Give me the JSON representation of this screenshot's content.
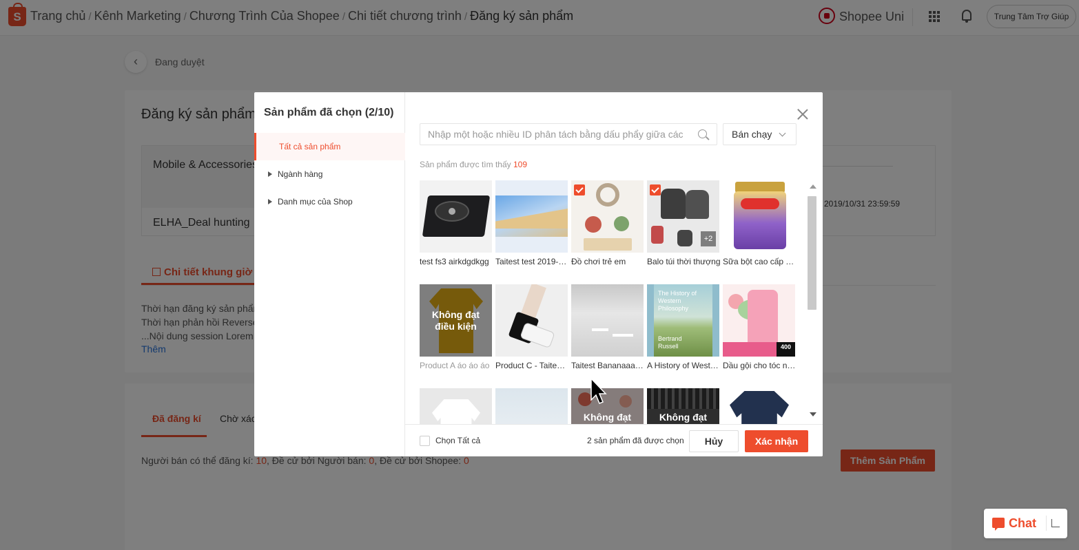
{
  "header": {
    "breadcrumb": [
      "Trang chủ",
      "Kênh Marketing",
      "Chương Trình Của Shopee",
      "Chi tiết chương trình"
    ],
    "breadcrumb_current": "Đăng ký sản phẩm",
    "shopee_uni": "Shopee Uni",
    "help_center": "Trung Tâm Trợ Giúp"
  },
  "page": {
    "status": "Đang duyệt",
    "title": "Đăng ký sản phẩm",
    "category": "Mobile & Accessories",
    "session": "ELHA_Deal hunting",
    "date_end": "2019/10/31 23:59:59",
    "detail_tab": "Chi tiết khung giờ",
    "info_lines": [
      "Thời hạn đăng ký sản phẩm",
      "Thời hạn phản hồi Reverse",
      "...Nội dung session Lorem"
    ],
    "more_link": "Thêm",
    "tabs": [
      "Đã đăng kí",
      "Chờ xác"
    ],
    "seller_info": {
      "label_can_register": "Người bán có thể đăng kí: ",
      "can_register": "10",
      "label_by_seller": ", Đề cử bởi Người bán: ",
      "by_seller": "0",
      "label_by_shopee": ", Đề cử bởi Shopee: ",
      "by_shopee": "0"
    },
    "add_product_button": "Thêm Sản Phẩm"
  },
  "modal": {
    "title": "Sản phẩm đã chọn (2/10)",
    "filters": [
      {
        "label": "Tất cả sản phẩm",
        "active": true
      },
      {
        "label": "Ngành hàng",
        "active": false
      },
      {
        "label": "Danh mục của Shop",
        "active": false
      }
    ],
    "search_placeholder": "Nhập một hoặc nhiều ID phân tách bằng dấu phẩy giữa các",
    "sort_selected": "Bán chạy",
    "found_label": "Sản phẩm được tìm thấy",
    "found_count": "109",
    "products": [
      {
        "name": "test fs3 airkdgdkgg",
        "checked": false,
        "ineligible": ""
      },
      {
        "name": "Taitest test 2019-…",
        "checked": false,
        "ineligible": ""
      },
      {
        "name": "Đồ chơi trẻ em",
        "checked": true,
        "ineligible": ""
      },
      {
        "name": "Balo túi thời thượng",
        "checked": true,
        "ineligible": "",
        "extra_badge": "+2"
      },
      {
        "name": "Sữa bột cao cấp T…",
        "checked": false,
        "ineligible": ""
      },
      {
        "name": "Product A áo áo áo",
        "checked": false,
        "ineligible": "Không đạt điều kiện"
      },
      {
        "name": "Product C - Taites…",
        "checked": false,
        "ineligible": ""
      },
      {
        "name": "Taitest Bananaaa…",
        "checked": false,
        "ineligible": ""
      },
      {
        "name": "A History of West…",
        "checked": false,
        "ineligible": "",
        "book_text": "The History of Western Philosophy",
        "book_author": "Bertrand Russell"
      },
      {
        "name": "Dầu gội cho tóc n…",
        "checked": false,
        "ineligible": "",
        "bottle_text": "400"
      },
      {
        "name": "",
        "checked": false,
        "ineligible": ""
      },
      {
        "name": "",
        "checked": false,
        "ineligible": ""
      },
      {
        "name": "",
        "checked": false,
        "ineligible": "Không đạt"
      },
      {
        "name": "",
        "checked": false,
        "ineligible": "Không đạt"
      },
      {
        "name": "",
        "checked": false,
        "ineligible": ""
      }
    ],
    "select_all": "Chọn Tất cả",
    "selected_summary": "2 sản phẩm đã được chọn",
    "cancel": "Hủy",
    "confirm": "Xác nhận"
  },
  "chat": {
    "label": "Chat"
  },
  "colors": {
    "brand": "#ee4d2d",
    "deep_brand": "#d0011b"
  }
}
